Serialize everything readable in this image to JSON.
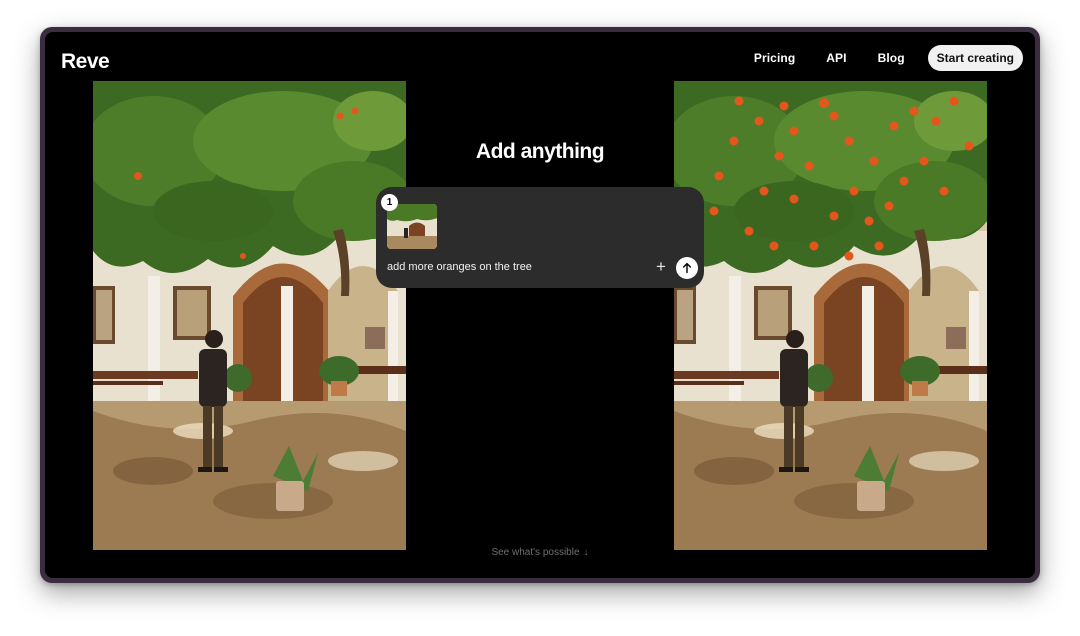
{
  "header": {
    "logo": "Reve",
    "nav": [
      {
        "label": "Pricing"
      },
      {
        "label": "API"
      },
      {
        "label": "Blog"
      }
    ],
    "cta_label": "Start creating"
  },
  "hero": {
    "headline": "Add anything",
    "prompt": {
      "attachment_count": "1",
      "text": "add more oranges on the tree",
      "plus_icon": "plus-icon",
      "send_icon": "arrow-up-icon"
    },
    "see_more": "See what's possible",
    "see_more_arrow": "↓"
  },
  "colors": {
    "background": "#000000",
    "frame": "#3a2d3f",
    "card": "#2c2c2c",
    "cta_bg": "#f1f1f1",
    "orange_fruit": "#e3561c"
  }
}
